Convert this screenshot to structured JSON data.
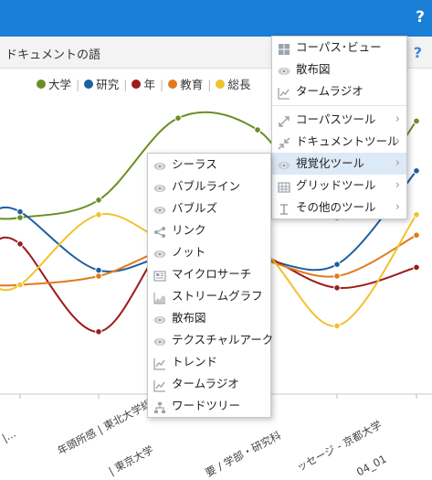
{
  "topbar": {
    "help_label": "?"
  },
  "subbar": {
    "title": "ドキュメントの語",
    "help_label": "?"
  },
  "legend": [
    {
      "label": "大学",
      "color": "#6b8e23"
    },
    {
      "label": "研究",
      "color": "#1c5fa3"
    },
    {
      "label": "年",
      "color": "#9b1c1c"
    },
    {
      "label": "教育",
      "color": "#e07b1a"
    },
    {
      "label": "総長",
      "color": "#f2c12e"
    }
  ],
  "x_tick_labels": [
    "歩 |...",
    "年頭所感 | 東北大学総...",
    "| 東京大学",
    "要 / 学部・研究科",
    "ッセージ - 京都大学",
    "04_01"
  ],
  "tools_menu": {
    "items": [
      {
        "label": "コーパス･ビュー",
        "icon": "window-icon",
        "has_submenu": false
      },
      {
        "label": "散布図",
        "icon": "eye-icon",
        "has_submenu": false
      },
      {
        "label": "タームラジオ",
        "icon": "line-chart-icon",
        "has_submenu": false
      },
      {
        "separator": true
      },
      {
        "label": "コーパスツール",
        "icon": "expand-icon",
        "has_submenu": true
      },
      {
        "label": "ドキュメントツール",
        "icon": "collapse-icon",
        "has_submenu": true
      },
      {
        "label": "視覚化ツール",
        "icon": "eye-icon",
        "has_submenu": true,
        "selected": true
      },
      {
        "label": "グリッドツール",
        "icon": "grid-icon",
        "has_submenu": true
      },
      {
        "label": "その他のツール",
        "icon": "text-cursor-icon",
        "has_submenu": true
      }
    ]
  },
  "viz_submenu": {
    "items": [
      {
        "label": "シーラス",
        "icon": "eye-icon"
      },
      {
        "label": "バブルライン",
        "icon": "eye-icon"
      },
      {
        "label": "バブルズ",
        "icon": "eye-icon"
      },
      {
        "label": "リンク",
        "icon": "share-icon"
      },
      {
        "label": "ノット",
        "icon": "eye-icon"
      },
      {
        "label": "マイクロサーチ",
        "icon": "newspaper-icon"
      },
      {
        "label": "ストリームグラフ",
        "icon": "area-chart-icon"
      },
      {
        "label": "散布図",
        "icon": "eye-icon"
      },
      {
        "label": "テクスチャルアーク",
        "icon": "eye-icon"
      },
      {
        "label": "トレンド",
        "icon": "line-chart-icon"
      },
      {
        "label": "タームラジオ",
        "icon": "line-chart-icon"
      },
      {
        "label": "ワードツリー",
        "icon": "sitemap-icon"
      }
    ]
  },
  "chart_data": {
    "type": "line",
    "x": [
      0,
      1,
      2,
      3,
      4,
      5
    ],
    "series": [
      {
        "name": "大学",
        "color": "#6b8e23",
        "values": [
          0.6,
          0.66,
          0.94,
          0.9,
          0.6,
          0.93
        ]
      },
      {
        "name": "研究",
        "color": "#1c5fa3",
        "values": [
          0.62,
          0.42,
          0.48,
          0.46,
          0.44,
          0.76
        ]
      },
      {
        "name": "年",
        "color": "#9b1c1c",
        "values": [
          0.51,
          0.21,
          0.56,
          0.48,
          0.36,
          0.43
        ]
      },
      {
        "name": "教育",
        "color": "#e07b1a",
        "values": [
          0.37,
          0.4,
          0.5,
          0.46,
          0.4,
          0.54
        ]
      },
      {
        "name": "総長",
        "color": "#f2c12e",
        "values": [
          0.37,
          0.61,
          0.5,
          0.5,
          0.23,
          0.61
        ]
      }
    ],
    "grid": false,
    "legend_position": "top"
  }
}
